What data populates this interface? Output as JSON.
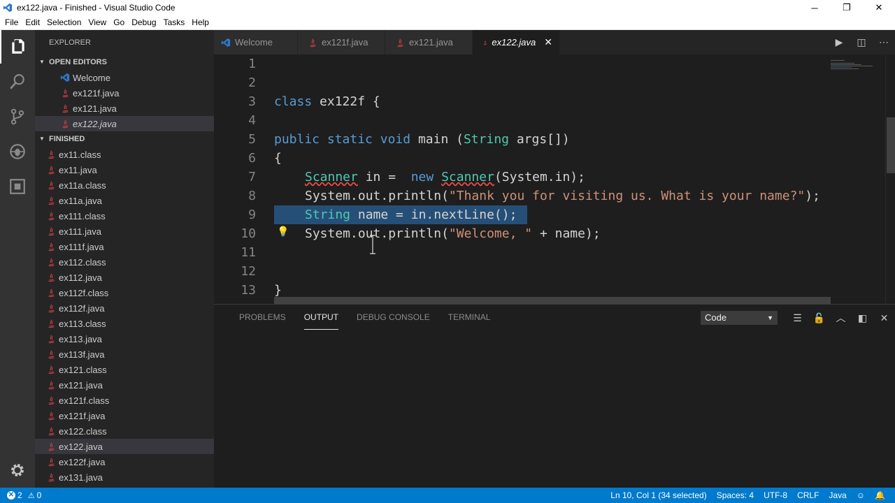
{
  "window": {
    "title": "ex122.java - Finished - Visual Studio Code",
    "minimize": "─",
    "restore": "❐",
    "close": "✕"
  },
  "menu": [
    "File",
    "Edit",
    "Selection",
    "View",
    "Go",
    "Debug",
    "Tasks",
    "Help"
  ],
  "sidebar": {
    "title": "EXPLORER",
    "open_editors_label": "OPEN EDITORS",
    "open_editors": [
      "Welcome",
      "ex121f.java",
      "ex121.java",
      "ex122.java"
    ],
    "folder_label": "FINISHED",
    "files": [
      "ex11.class",
      "ex11.java",
      "ex11a.class",
      "ex11a.java",
      "ex111.class",
      "ex111.java",
      "ex111f.java",
      "ex112.class",
      "ex112.java",
      "ex112f.class",
      "ex112f.java",
      "ex113.class",
      "ex113.java",
      "ex113f.java",
      "ex121.class",
      "ex121.java",
      "ex121f.class",
      "ex121f.java",
      "ex122.class",
      "ex122.java",
      "ex122f.java",
      "ex131.java"
    ],
    "selected_file": "ex122.java"
  },
  "tabs": [
    {
      "label": "Welcome",
      "icon": "vscode-icon"
    },
    {
      "label": "ex121f.java",
      "icon": "java-icon"
    },
    {
      "label": "ex121.java",
      "icon": "java-icon"
    },
    {
      "label": "ex122.java",
      "icon": "java-icon",
      "active": true
    }
  ],
  "editor": {
    "line_numbers": [
      "1",
      "2",
      "3",
      "4",
      "5",
      "6",
      "7",
      "8",
      "9",
      "10",
      "11",
      "12",
      "13"
    ],
    "code": {
      "l3_kw": "class",
      "l3_rest": " ex122f {",
      "l5_kw1": "public",
      "l5_kw2": "static",
      "l5_kw3": "void",
      "l5_main": " main (",
      "l5_type": "String",
      "l5_rest": " args[])",
      "l6": "{",
      "l7_type": "Scanner",
      "l7_mid": " in =  ",
      "l7_new": "new",
      "l7_sp": " ",
      "l7_type2": "Scanner",
      "l7_rest": "(System.in);",
      "l8_pre": "System.out.println(",
      "l8_str": "\"Thank you for visiting us. What is your name?\"",
      "l8_post": ");",
      "l9_type": "String",
      "l9_rest": " name = in.nextLine();",
      "l10_pre": "System.out.println(",
      "l10_str": "\"Welcome, \"",
      "l10_post": " + name);",
      "l13": "}"
    }
  },
  "panel": {
    "tabs": [
      "PROBLEMS",
      "OUTPUT",
      "DEBUG CONSOLE",
      "TERMINAL"
    ],
    "active_tab": "OUTPUT",
    "output_channel": "Code"
  },
  "status": {
    "errors": "2",
    "warnings": "0",
    "position": "Ln 10, Col 1 (34 selected)",
    "spaces": "Spaces: 4",
    "encoding": "UTF-8",
    "eol": "CRLF",
    "language": "Java"
  },
  "colors": {
    "statusbar": "#007acc",
    "keyword": "#569cd6",
    "type": "#4ec9b0",
    "string": "#ce9178",
    "selection": "#264f78"
  }
}
